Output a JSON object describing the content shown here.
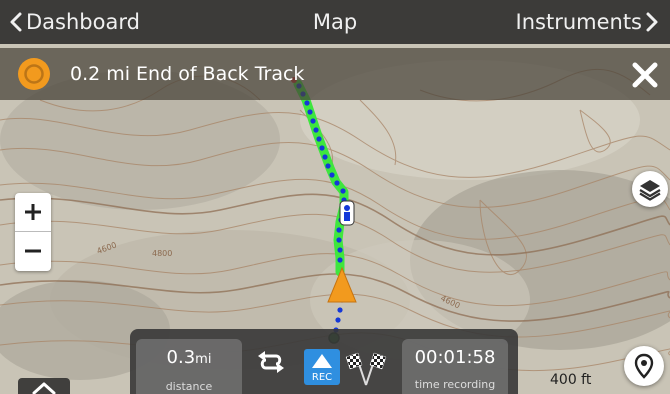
{
  "topbar": {
    "left_label": "Dashboard",
    "title": "Map",
    "right_label": "Instruments"
  },
  "banner": {
    "distance": "0.2 mi",
    "target": "End of Back Track"
  },
  "map": {
    "contour_labels": [
      "4600",
      "4800",
      "4600"
    ],
    "scale_label": "400 ft"
  },
  "zoom": {
    "in_label": "+",
    "out_label": "−"
  },
  "stats": {
    "distance_value": "0.3",
    "distance_unit": "mi",
    "distance_label": "distance",
    "time_value": "00:01:58",
    "time_label": "time recording"
  },
  "controls": {
    "rec_label": "REC"
  },
  "colors": {
    "route_green": "#3ee63e",
    "track_blue": "#1438d8",
    "waypoint_orange": "#f29a1e",
    "rec_blue": "#2f8fe0"
  },
  "icons": [
    "chevron-left-icon",
    "chevron-right-icon",
    "target-ring-icon",
    "close-icon",
    "layers-icon",
    "location-pin-icon",
    "reverse-icon",
    "record-icon",
    "checkered-flags-icon",
    "chevron-up-icon"
  ]
}
